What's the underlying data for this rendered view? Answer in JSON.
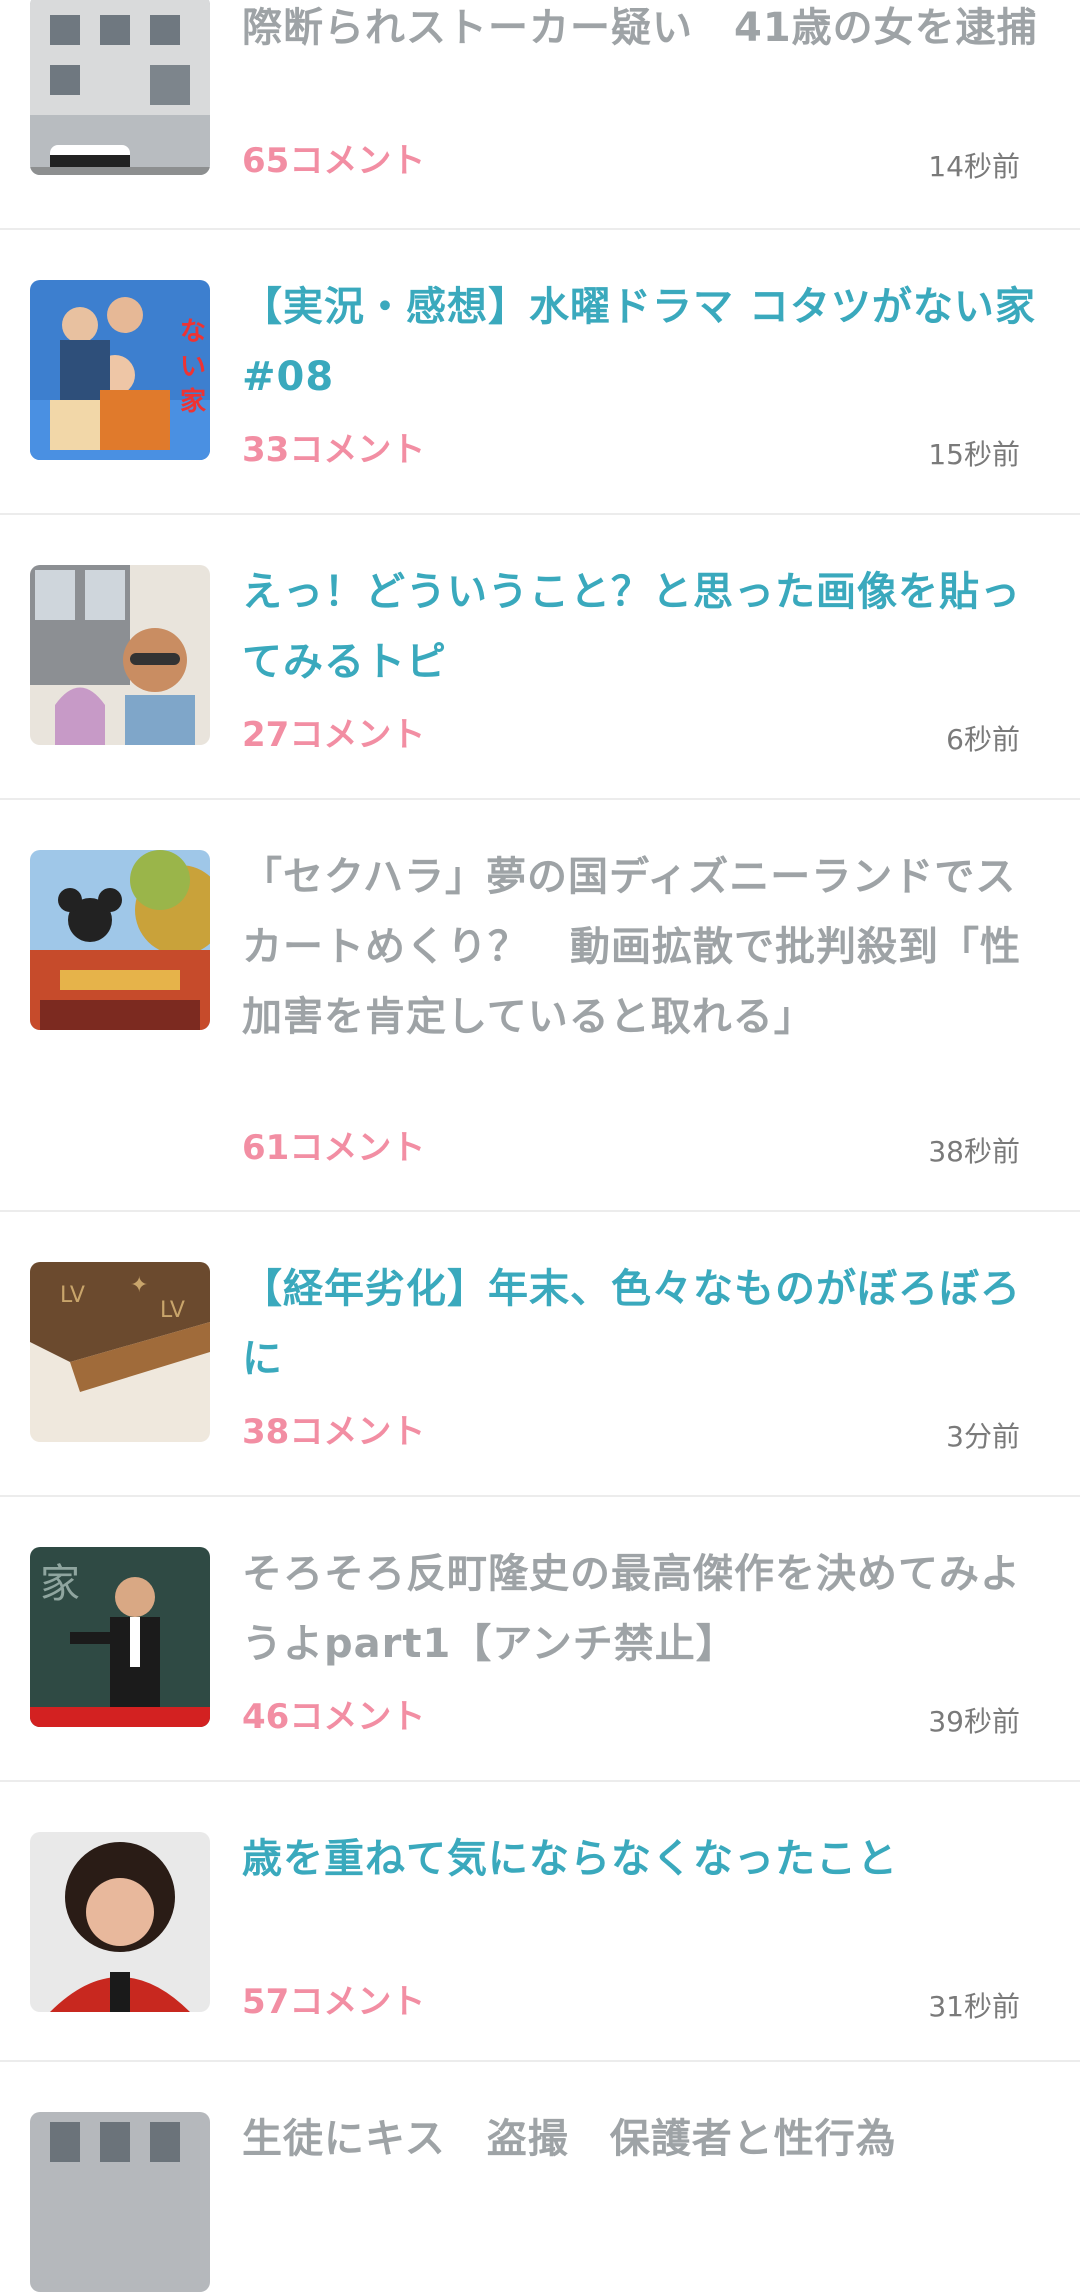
{
  "items": [
    {
      "title": "際断られストーカー疑い　41歳の女を逮捕",
      "title_state": "read",
      "comments": "65コメント",
      "time": "14秒前",
      "thumb": "police-station-photo"
    },
    {
      "title": "【実況・感想】水曜ドラマ コタツがない家 #08",
      "title_state": "unread",
      "comments": "33コメント",
      "time": "15秒前",
      "thumb": "drama-poster-photo"
    },
    {
      "title": "えっ！どういうこと？と思った画像を貼ってみるトピ",
      "title_state": "unread",
      "comments": "27コメント",
      "time": "6秒前",
      "thumb": "selfie-photo"
    },
    {
      "title": "「セクハラ」夢の国ディズニーランドでスカートめくり？　動画拡散で批判殺到「性加害を肯定していると取れる」",
      "title_state": "read",
      "comments": "61コメント",
      "time": "38秒前",
      "thumb": "parade-float-photo"
    },
    {
      "title": "【経年劣化】年末、色々なものがぼろぼろに",
      "title_state": "unread",
      "comments": "38コメント",
      "time": "3分前",
      "thumb": "worn-wallet-photo"
    },
    {
      "title": "そろそろ反町隆史の最高傑作を決めてみようよpart1【アンチ禁止】",
      "title_state": "read",
      "comments": "46コメント",
      "time": "39秒前",
      "thumb": "teacher-chalkboard-photo"
    },
    {
      "title": "歳を重ねて気にならなくなったこと",
      "title_state": "unread",
      "comments": "57コメント",
      "time": "31秒前",
      "thumb": "woman-portrait-photo"
    },
    {
      "title": "生徒にキス　盗撮　保護者と性行為",
      "title_state": "read",
      "comments": "",
      "time": "",
      "thumb": "building-photo"
    }
  ]
}
